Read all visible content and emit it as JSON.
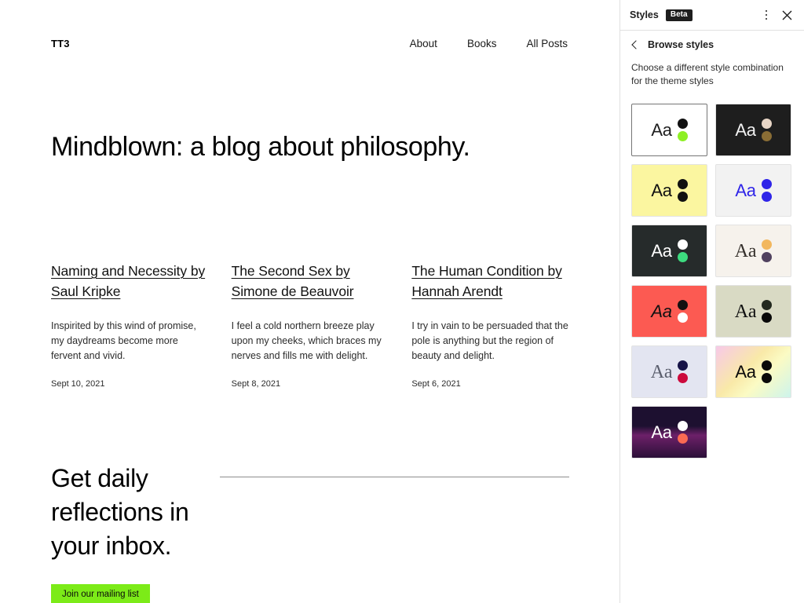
{
  "site": {
    "title": "TT3",
    "nav": [
      {
        "label": "About"
      },
      {
        "label": "Books"
      },
      {
        "label": "All Posts"
      }
    ],
    "hero_heading": "Mindblown: a blog about philosophy.",
    "posts": [
      {
        "title": "Naming and Necessity by Saul Kripke",
        "excerpt": "Inspirited by this wind of promise, my daydreams become more fervent and vivid.",
        "date": "Sept 10, 2021"
      },
      {
        "title": "The Second Sex by Simone de Beauvoir",
        "excerpt": "I feel a cold northern breeze play upon my cheeks, which braces my nerves and fills me with delight.",
        "date": "Sept 8, 2021"
      },
      {
        "title": "The Human Condition by Hannah Arendt",
        "excerpt": "I try in vain to be persuaded that the pole is anything but the region of beauty and delight.",
        "date": "Sept 6, 2021"
      }
    ],
    "newsletter": {
      "heading": "Get daily reflections in your inbox.",
      "button_label": "Join our mailing list",
      "button_color": "#7ceb18"
    }
  },
  "sidebar": {
    "title": "Styles",
    "beta_badge": "Beta",
    "more_icon": "more-vertical-icon",
    "close_icon": "close-icon",
    "back_icon": "chevron-left-icon",
    "back_label": "Browse styles",
    "description": "Choose a different style combination for the theme styles",
    "swatch_sample_text": "Aa",
    "swatches": [
      {
        "name": "default",
        "active": true,
        "background": "#ffffff",
        "text_color": "#1e1e1e",
        "font": "sans",
        "dot_top": "#111111",
        "dot_bottom": "#8ef024"
      },
      {
        "name": "dark-brown",
        "active": false,
        "background": "#1e1e1e",
        "text_color": "#f2f2f2",
        "font": "sans",
        "dot_top": "#e8d6c6",
        "dot_bottom": "#8a6d35"
      },
      {
        "name": "yellow",
        "active": false,
        "background": "#fbf6a0",
        "text_color": "#111111",
        "font": "sans",
        "dot_top": "#111111",
        "dot_bottom": "#111111"
      },
      {
        "name": "blue-on-grey",
        "active": false,
        "background": "#f2f2f2",
        "text_color": "#2f25e8",
        "font": "sans",
        "dot_top": "#2f25e8",
        "dot_bottom": "#2f25e8"
      },
      {
        "name": "dark-green",
        "active": false,
        "background": "#262b2b",
        "text_color": "#ffffff",
        "font": "sans",
        "dot_top": "#ffffff",
        "dot_bottom": "#3ddb7f"
      },
      {
        "name": "cream-serif",
        "active": false,
        "background": "#f6f2ec",
        "text_color": "#36312c",
        "font": "serif",
        "dot_top": "#f2b75e",
        "dot_bottom": "#50415f"
      },
      {
        "name": "red-italic",
        "active": false,
        "background": "#fc5a52",
        "text_color": "#111111",
        "font": "sans-italic",
        "dot_top": "#111111",
        "dot_bottom": "#ffffff"
      },
      {
        "name": "sage-serif",
        "active": false,
        "background": "#d9dac4",
        "text_color": "#111111",
        "font": "serif",
        "dot_top": "#23291f",
        "dot_bottom": "#090909"
      },
      {
        "name": "lavender-serif",
        "active": false,
        "background": "#e3e5f1",
        "text_color": "#5b5f6e",
        "font": "serif",
        "dot_top": "#171347",
        "dot_bottom": "#cc0a3c"
      },
      {
        "name": "pastel-gradient",
        "active": false,
        "background": "linear-gradient(135deg, #f7c9e8 0%, #f9e9a8 42%, #fbfbc4 62%, #cdf4ec 100%)",
        "text_color": "#0a0a0a",
        "font": "sans",
        "dot_top": "#0a0a0a",
        "dot_bottom": "#0a0a0a"
      },
      {
        "name": "purple-gradient",
        "active": false,
        "background": "linear-gradient(180deg, #1d1030 0%, #1d1030 38%, #6d2069 56%, #2b1038 100%)",
        "text_color": "#ffffff",
        "font": "sans",
        "dot_top": "#ffffff",
        "dot_bottom": "#fa6a53"
      }
    ]
  }
}
